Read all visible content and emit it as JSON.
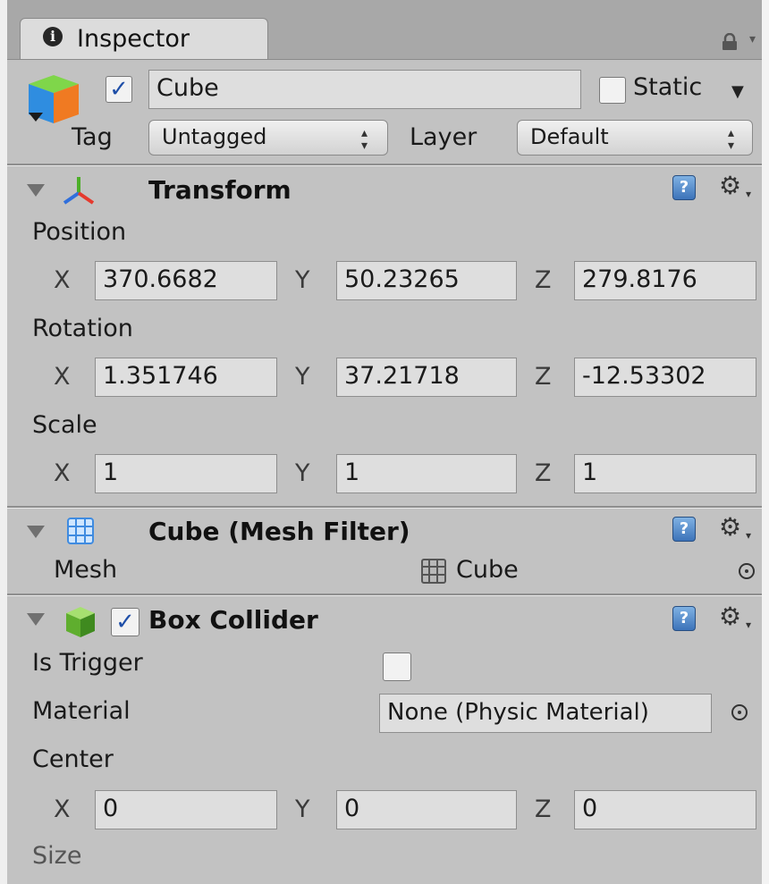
{
  "window": {
    "tab_title": "Inspector"
  },
  "header": {
    "object_name": "Cube",
    "active": true,
    "static_label": "Static",
    "static_checked": false,
    "tag_label": "Tag",
    "tag_value": "Untagged",
    "layer_label": "Layer",
    "layer_value": "Default"
  },
  "transform": {
    "title": "Transform",
    "position_label": "Position",
    "rotation_label": "Rotation",
    "scale_label": "Scale",
    "axis_labels": [
      "X",
      "Y",
      "Z"
    ],
    "position": [
      "370.6682",
      "50.23265",
      "279.8176"
    ],
    "rotation": [
      "1.351746",
      "37.21718",
      "-12.53302"
    ],
    "scale": [
      "1",
      "1",
      "1"
    ]
  },
  "mesh_filter": {
    "title": "Cube (Mesh Filter)",
    "mesh_label": "Mesh",
    "mesh_value": "Cube"
  },
  "box_collider": {
    "title": "Box Collider",
    "enabled": true,
    "is_trigger_label": "Is Trigger",
    "is_trigger": false,
    "material_label": "Material",
    "material_value": "None (Physic Material)",
    "center_label": "Center",
    "center": [
      "0",
      "0",
      "0"
    ],
    "size_label": "Size"
  },
  "icons": {
    "info": "info-icon",
    "lock": "lock-icon",
    "gameobject": "cube-object-icon",
    "transform": "transform-axes-icon",
    "mesh_filter": "mesh-grid-icon",
    "box_collider": "green-box-icon",
    "help": "help-book-icon",
    "settings": "gear-icon",
    "object_picker": "target-picker-icon"
  },
  "colors": {
    "panel_bg": "#c2c2c2",
    "field_bg": "#dedede",
    "check_blue": "#1f4fa8"
  }
}
